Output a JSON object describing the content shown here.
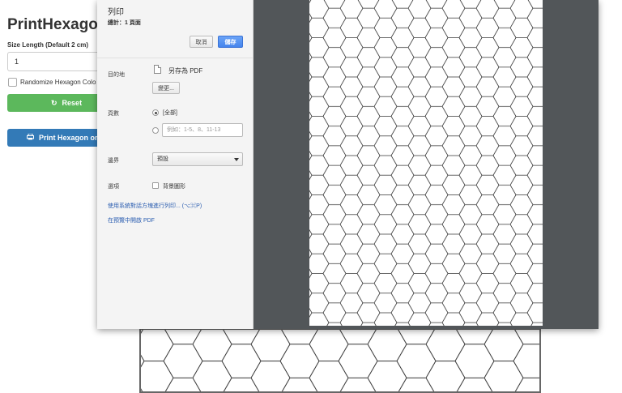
{
  "page": {
    "title": "PrintHexagon",
    "size_label": "Size Length (Default 2 cm)",
    "size_value": "1",
    "randomize_label": "Randomize Hexagon Colo",
    "reset_label": "Reset",
    "print_label": "Print Hexagon on A"
  },
  "dialog": {
    "title": "列印",
    "total": "總計：1 頁面",
    "cancel_label": "取消",
    "save_label": "儲存",
    "destination_label": "目的地",
    "destination_value": "另存為 PDF",
    "change_label": "變更...",
    "pages_label": "頁數",
    "pages_all_label": "[全部]",
    "pages_placeholder": "例如：1-5、8、11-13",
    "margins_label": "邊界",
    "margins_value": "預設",
    "options_label": "選項",
    "background_graphics_label": "背景圖形",
    "system_dialog_link": "使用系統對話方塊進行列印... (⌥⌘P)",
    "open_pdf_link": "在預覽中開啟 PDF"
  },
  "colors": {
    "reset_button": "#5cb85c",
    "print_button": "#337ab7",
    "save_button": "#4585ed",
    "preview_background": "#525659",
    "hex_stroke": "#333333"
  },
  "icons": {
    "reset": "refresh-icon",
    "print": "printer-icon",
    "destination": "file-icon",
    "margins": "chevron-down-icon"
  }
}
